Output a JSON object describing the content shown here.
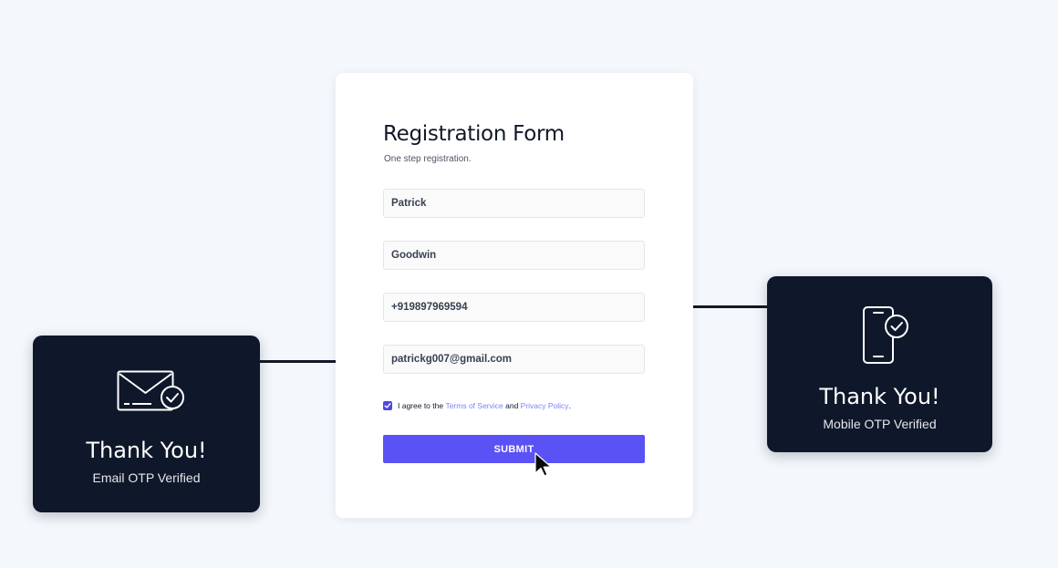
{
  "form": {
    "title": "Registration Form",
    "subtitle": "One step registration.",
    "fields": {
      "first_name": "Patrick",
      "last_name": "Goodwin",
      "phone": "+919897969594",
      "email": "patrickg007@gmail.com"
    },
    "agreement": {
      "checked": true,
      "prefix": "I agree to the ",
      "terms_link": "Terms of Service",
      "middle": " and ",
      "privacy_link": "Privacy Policy",
      "suffix": "."
    },
    "submit_label": "SUBMIT"
  },
  "email_card": {
    "icon": "envelope-check-icon",
    "title": "Thank You!",
    "subtitle": "Email OTP Verified"
  },
  "mobile_card": {
    "icon": "phone-check-icon",
    "title": "Thank You!",
    "subtitle": "Mobile OTP Verified"
  },
  "colors": {
    "background": "#f4f8fc",
    "card_dark": "#0f172a",
    "accent": "#5a52f5",
    "link": "#7c83f5"
  }
}
